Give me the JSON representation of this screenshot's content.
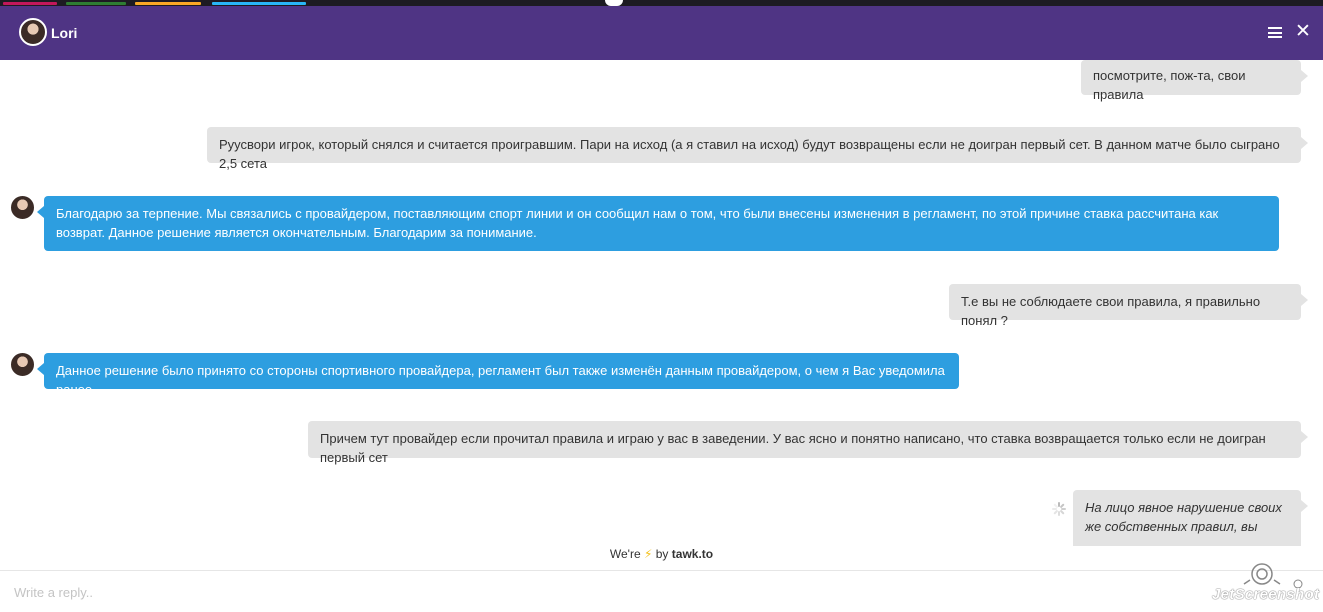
{
  "header": {
    "agent_name": "Lori",
    "menu_icon": "hamburger-menu-icon",
    "close_icon": "close-icon",
    "close_glyph": "✕",
    "color": "#4f3484"
  },
  "messages": [
    {
      "sender": "visitor",
      "text": "посмотрите, пож-та, свои правила"
    },
    {
      "sender": "visitor",
      "text": "Руусвори игрок, который снялся и считается проигравшим.  Пари на исход (а я ставил на исход) будут возвращены если не доигран первый сет. В данном матче было сыграно 2,5 сета"
    },
    {
      "sender": "agent",
      "text": "Благодарю за терпение. Мы связались с провайдером, поставляющим спорт линии и он сообщил нам о том, что были внесены изменения в регламент, по этой причине ставка рассчитана как возврат. Данное решение является окончательным. Благодарим за понимание."
    },
    {
      "sender": "visitor",
      "text": "Т.е вы не соблюдаете свои правила, я правильно понял ?"
    },
    {
      "sender": "agent",
      "text": "Данное решение было принято со стороны спортивного провайдера, регламент был также изменён данным провайдером, о чем я Вас уведомила ранее."
    },
    {
      "sender": "visitor",
      "text": "Причем тут провайдер если прочитал правила и играю у вас в заведении. У вас ясно и понятно написано, что ставка возвращается только если не доигран первый сет"
    },
    {
      "sender": "visitor",
      "status": "sending",
      "text": "На лицо явное нарушение своих же собственных правил, вы"
    }
  ],
  "footer": {
    "powered_prefix": "We're",
    "bolt_glyph": "⚡",
    "powered_by": "by",
    "brand": "tawk.to"
  },
  "composer": {
    "placeholder": "Write a reply.."
  },
  "watermark": {
    "text": "JetScreenshot"
  },
  "colors": {
    "agent_bubble": "#2d9ee0",
    "visitor_bubble": "#e3e3e3",
    "header": "#4f3484"
  }
}
